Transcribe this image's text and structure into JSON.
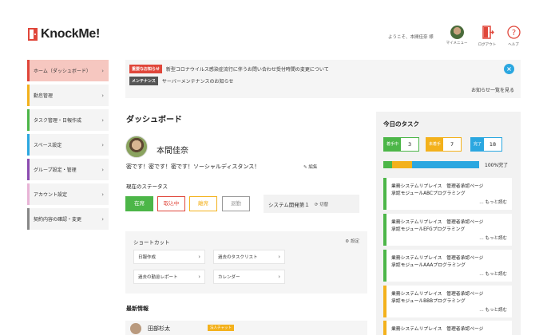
{
  "header": {
    "logo_text": "KnockMe!",
    "welcome": "ようこそ、本間佳奈 様",
    "mypage_label": "マイメニュー",
    "logout_label": "ログアウト",
    "help_label": "ヘルプ"
  },
  "sidebar": {
    "items": [
      {
        "label": "ホーム（ダッシュボード）",
        "color": "#e0463a"
      },
      {
        "label": "勤怠管理",
        "color": "#f3b11c"
      },
      {
        "label": "タスク管理・日報作成",
        "color": "#4cb648"
      },
      {
        "label": "スペース設定",
        "color": "#2ba7e0"
      },
      {
        "label": "グループ設定・管理",
        "color": "#8c4bb0"
      },
      {
        "label": "アカウント設定",
        "color": "#e8b4d6"
      },
      {
        "label": "契約内容の確認・変更",
        "color": "#888888"
      }
    ]
  },
  "notices": {
    "items": [
      {
        "tag": "重要なお知らせ",
        "tag_color": "#e0463a",
        "text": "新型コロナウイルス感染症流行に伴うお問い合わせ受付時間の変更について"
      },
      {
        "tag": "メンテナンス",
        "tag_color": "#555555",
        "text": "サーバーメンテナンスのお知らせ"
      }
    ],
    "link": "お知らせ一覧を見る"
  },
  "dashboard": {
    "title": "ダッシュボード",
    "user_name": "本間佳奈",
    "message": "密です！密です！密です！ソーシャルディスタンス！",
    "edit_label": "編集",
    "status_label": "現在のステータス",
    "statuses": [
      "在席",
      "取込中",
      "離席",
      "退勤"
    ],
    "department": "システム開発第１",
    "switch_label": "切替"
  },
  "shortcut": {
    "title": "ショートカット",
    "settings_label": "設定",
    "items": [
      "日報作成",
      "過去のタスクリスト",
      "過去の勤怠レポート",
      "カレンダー"
    ]
  },
  "news": {
    "title": "最新情報",
    "name": "田部杉太",
    "tag": "法人チャット"
  },
  "tasks": {
    "title": "今日のタスク",
    "counts": [
      {
        "label": "着手中",
        "value": "3",
        "color": "#4cb648"
      },
      {
        "label": "未着手",
        "value": "7",
        "color": "#f3b11c"
      },
      {
        "label": "完了",
        "value": "18",
        "color": "#2ba7e0"
      }
    ],
    "progress_label": "100%完了",
    "more_label": "… もっと読む",
    "cards": [
      {
        "line1": "業務システムリプレイス　管理者承認ページ",
        "line2": "承認モジュールABCプログラミング",
        "color": "#4cb648"
      },
      {
        "line1": "業務システムリプレイス　管理者承認ページ",
        "line2": "承認モジュールEFGプログラミング",
        "color": "#4cb648"
      },
      {
        "line1": "業務システムリプレイス　管理者承認ページ",
        "line2": "承認モジュールAAAプログラミング",
        "color": "#4cb648"
      },
      {
        "line1": "業務システムリプレイス　管理者承認ページ",
        "line2": "承認モジュールBBBプログラミング",
        "color": "#f3b11c"
      },
      {
        "line1": "業務システムリプレイス　管理者承認ページ",
        "line2": "",
        "color": "#f3b11c"
      }
    ]
  }
}
